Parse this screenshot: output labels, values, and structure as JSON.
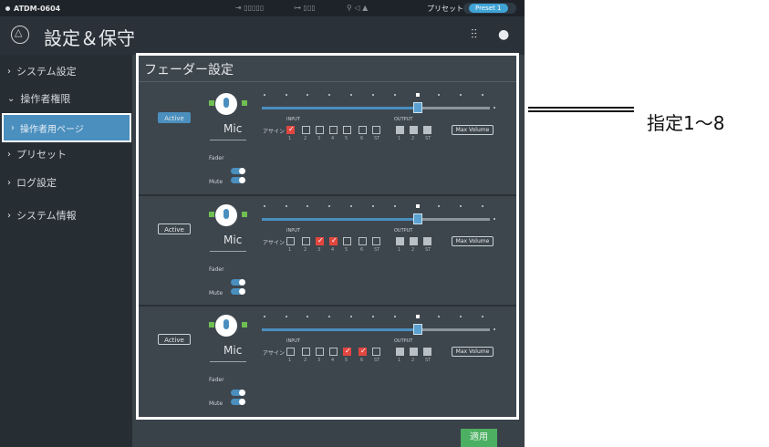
{
  "topbar": {
    "device_name": "ATDM-0604",
    "indicator_1": "⇥ ▯▯▯▯▯",
    "indicator_2": "⊶ ▯▯▯",
    "indicator_3": "⚲ ◁ ▲",
    "preset_label": "プリセット",
    "preset_value": "Preset 1"
  },
  "header": {
    "title": "設定＆保守"
  },
  "sidebar": {
    "items": [
      {
        "label": "システム設定",
        "chevron": "›"
      },
      {
        "label": "操作者権限",
        "chevron": "⌄"
      },
      {
        "label": "操作者用ページ",
        "chevron": "›"
      },
      {
        "label": "プリセット",
        "chevron": "›"
      },
      {
        "label": "ログ設定",
        "chevron": "›"
      },
      {
        "label": "システム情報",
        "chevron": "›"
      }
    ]
  },
  "panel": {
    "title": "フェーダー設定",
    "channels": [
      {
        "active_label": "Active",
        "active_on": true,
        "mic_label": "Mic",
        "fader_label": "Fader",
        "mute_label": "Mute",
        "input_label": "INPUT",
        "output_label": "OUTPUT",
        "assign_label": "アサイン",
        "input_checked": [
          true,
          false,
          false,
          false,
          false,
          false,
          false
        ],
        "max_volume_label": "Max Volume"
      },
      {
        "active_label": "Active",
        "active_on": false,
        "mic_label": "Mic",
        "fader_label": "Fader",
        "mute_label": "Mute",
        "input_label": "INPUT",
        "output_label": "OUTPUT",
        "assign_label": "アサイン",
        "input_checked": [
          false,
          false,
          true,
          true,
          false,
          false,
          false
        ],
        "max_volume_label": "Max Volume"
      },
      {
        "active_label": "Active",
        "active_on": false,
        "mic_label": "Mic",
        "fader_label": "Fader",
        "mute_label": "Mute",
        "input_label": "INPUT",
        "output_label": "OUTPUT",
        "assign_label": "アサイン",
        "input_checked": [
          false,
          false,
          false,
          false,
          true,
          true,
          false
        ],
        "max_volume_label": "Max Volume"
      }
    ],
    "input_numbers": [
      "1",
      "2",
      "3",
      "4",
      "5",
      "6",
      "ST"
    ],
    "output_numbers": [
      "1",
      "2",
      "ST"
    ]
  },
  "footer": {
    "apply_label": "適用"
  },
  "callout": {
    "text": "指定1〜8"
  },
  "colors": {
    "accent": "#4a8fbe",
    "checked": "#e2473f",
    "apply": "#4caf62"
  }
}
